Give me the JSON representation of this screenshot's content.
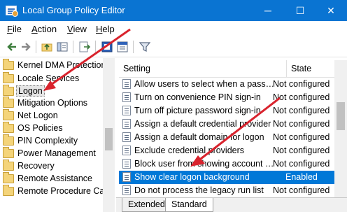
{
  "window": {
    "title": "Local Group Policy Editor",
    "minimize_glyph": "─",
    "maximize_glyph": "☐",
    "close_glyph": "✕"
  },
  "menu": {
    "items": [
      {
        "label": "File",
        "accel": "F",
        "rest": "ile"
      },
      {
        "label": "Action",
        "accel": "A",
        "rest": "ction"
      },
      {
        "label": "View",
        "accel": "V",
        "rest": "iew"
      },
      {
        "label": "Help",
        "accel": "H",
        "rest": "elp"
      }
    ]
  },
  "toolbar": {
    "icons": [
      "back-arrow-icon",
      "forward-arrow-icon",
      "up-folder-icon",
      "show-hide-tree-icon",
      "export-list-icon",
      "properties-icon",
      "help-icon",
      "filter-icon"
    ]
  },
  "tree": {
    "items": [
      {
        "label": "Kernel DMA Protection",
        "selected": false
      },
      {
        "label": "Locale Services",
        "selected": false
      },
      {
        "label": "Logon",
        "selected": true
      },
      {
        "label": "Mitigation Options",
        "selected": false
      },
      {
        "label": "Net Logon",
        "selected": false
      },
      {
        "label": "OS Policies",
        "selected": false
      },
      {
        "label": "PIN Complexity",
        "selected": false
      },
      {
        "label": "Power Management",
        "selected": false
      },
      {
        "label": "Recovery",
        "selected": false
      },
      {
        "label": "Remote Assistance",
        "selected": false
      },
      {
        "label": "Remote Procedure Call",
        "selected": false
      }
    ]
  },
  "list": {
    "columns": {
      "setting": "Setting",
      "state": "State"
    },
    "rows": [
      {
        "setting": "Allow users to select when a pass…",
        "state": "Not configured",
        "selected": false
      },
      {
        "setting": "Turn on convenience PIN sign-in",
        "state": "Not configured",
        "selected": false
      },
      {
        "setting": "Turn off picture password sign-in",
        "state": "Not configured",
        "selected": false
      },
      {
        "setting": "Assign a default credential provider",
        "state": "Not configured",
        "selected": false
      },
      {
        "setting": "Assign a default domain for logon",
        "state": "Not configured",
        "selected": false
      },
      {
        "setting": "Exclude credential providers",
        "state": "Not configured",
        "selected": false
      },
      {
        "setting": "Block user from showing account …",
        "state": "Not configured",
        "selected": false
      },
      {
        "setting": "Show clear logon background",
        "state": "Enabled",
        "selected": true
      },
      {
        "setting": "Do not process the legacy run list",
        "state": "Not configured",
        "selected": false
      }
    ]
  },
  "tabs": [
    {
      "label": "Extended",
      "active": false
    },
    {
      "label": "Standard",
      "active": true
    }
  ],
  "colors": {
    "titlebar": "#0a74d2",
    "selection": "#0078d7",
    "annotation_arrow": "#d9232d"
  }
}
